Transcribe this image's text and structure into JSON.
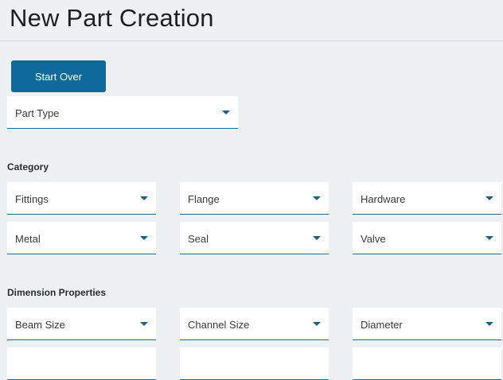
{
  "header": {
    "title": "New Part Creation"
  },
  "actions": {
    "start_over": "Start Over"
  },
  "part_type": {
    "label": "Part Type"
  },
  "category": {
    "heading": "Category",
    "items": [
      {
        "label": "Fittings"
      },
      {
        "label": "Flange"
      },
      {
        "label": "Hardware"
      },
      {
        "label": "Metal"
      },
      {
        "label": "Seal"
      },
      {
        "label": "Valve"
      }
    ]
  },
  "dimension": {
    "heading": "Dimension Properties",
    "items": [
      {
        "label": "Beam Size"
      },
      {
        "label": "Channel Size"
      },
      {
        "label": "Diameter"
      },
      {
        "label": ""
      },
      {
        "label": ""
      },
      {
        "label": ""
      }
    ]
  }
}
